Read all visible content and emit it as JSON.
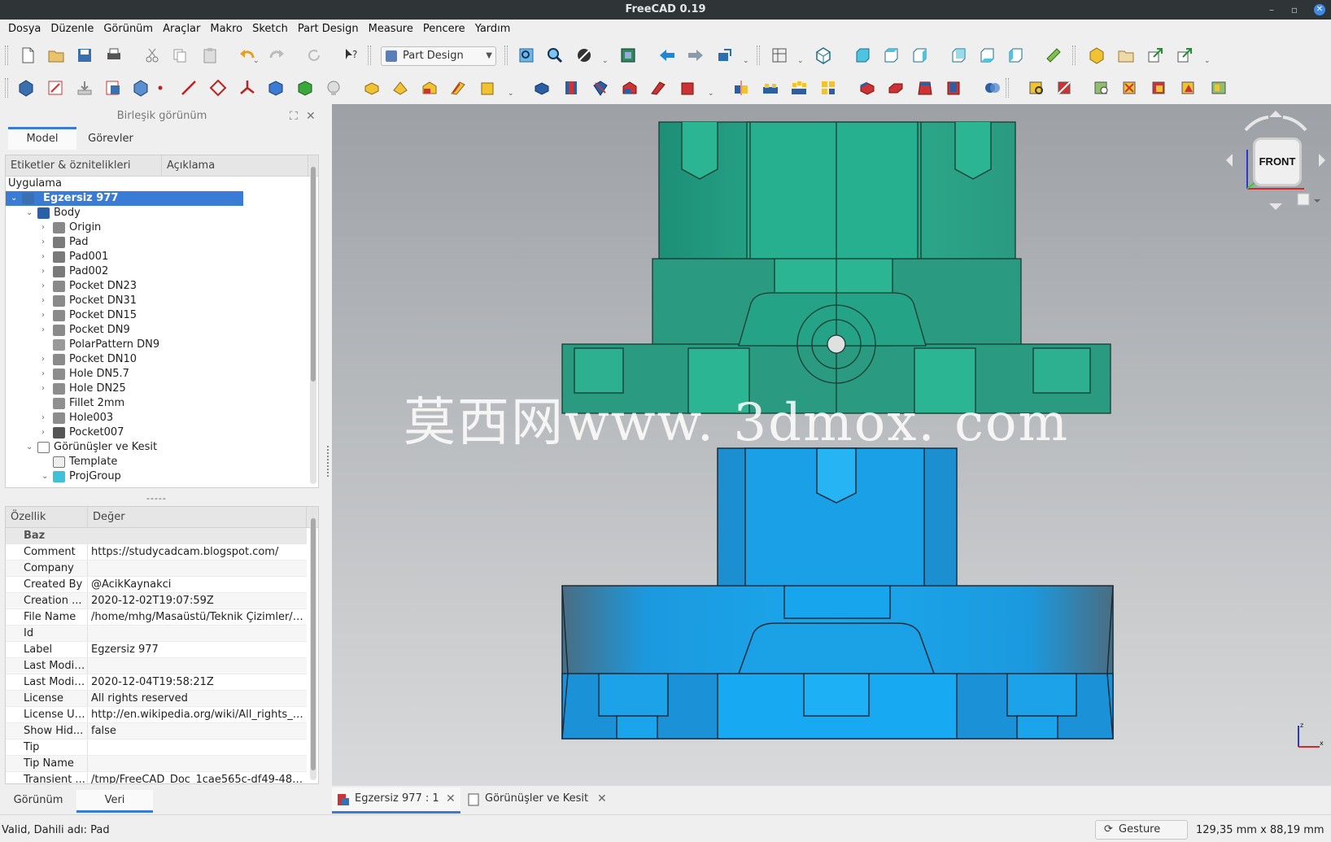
{
  "window": {
    "title": "FreeCAD 0.19",
    "minimize": "–",
    "restore": "▫",
    "close": "✕"
  },
  "menu": [
    "Dosya",
    "Düzenle",
    "Görünüm",
    "Araçlar",
    "Makro",
    "Sketch",
    "Part Design",
    "Measure",
    "Pencere",
    "Yardım"
  ],
  "workbench": {
    "selected": "Part Design"
  },
  "combo_view": {
    "title": "Birleşik görünüm",
    "tabs": [
      "Model",
      "Görevler"
    ],
    "active_tab": "Model"
  },
  "tree": {
    "columns": [
      "Etiketler & öznitelikleri",
      "Açıklama"
    ],
    "root_label": "Uygulama",
    "items": [
      {
        "label": "Egzersiz 977",
        "level": 0,
        "expander": "open",
        "icon": "document-icon",
        "selected": true
      },
      {
        "label": "Body",
        "level": 1,
        "expander": "open",
        "icon": "body-icon"
      },
      {
        "label": "Origin",
        "level": 2,
        "expander": "closed",
        "icon": "origin-icon"
      },
      {
        "label": "Pad",
        "level": 2,
        "expander": "closed",
        "icon": "pad-icon"
      },
      {
        "label": "Pad001",
        "level": 2,
        "expander": "closed",
        "icon": "pad-icon"
      },
      {
        "label": "Pad002",
        "level": 2,
        "expander": "closed",
        "icon": "pad-icon"
      },
      {
        "label": "Pocket DN23",
        "level": 2,
        "expander": "closed",
        "icon": "pocket-icon"
      },
      {
        "label": "Pocket DN31",
        "level": 2,
        "expander": "closed",
        "icon": "pocket-icon"
      },
      {
        "label": "Pocket DN15",
        "level": 2,
        "expander": "closed",
        "icon": "pocket-icon"
      },
      {
        "label": "Pocket DN9",
        "level": 2,
        "expander": "closed",
        "icon": "pocket-icon"
      },
      {
        "label": "PolarPattern DN9",
        "level": 2,
        "expander": "none",
        "icon": "polar-pattern-icon"
      },
      {
        "label": "Pocket DN10",
        "level": 2,
        "expander": "closed",
        "icon": "pocket-icon"
      },
      {
        "label": "Hole DN5.7",
        "level": 2,
        "expander": "closed",
        "icon": "hole-icon"
      },
      {
        "label": "Hole DN25",
        "level": 2,
        "expander": "closed",
        "icon": "hole-icon"
      },
      {
        "label": "Fillet 2mm",
        "level": 2,
        "expander": "none",
        "icon": "fillet-icon"
      },
      {
        "label": "Hole003",
        "level": 2,
        "expander": "closed",
        "icon": "hole-icon"
      },
      {
        "label": "Pocket007",
        "level": 2,
        "expander": "closed",
        "icon": "pocket-tip-icon"
      },
      {
        "label": "Görünüşler ve Kesit",
        "level": 1,
        "expander": "open",
        "icon": "page-icon"
      },
      {
        "label": "Template",
        "level": 2,
        "expander": "none",
        "icon": "template-icon"
      },
      {
        "label": "ProjGroup",
        "level": 2,
        "expander": "open",
        "icon": "projgroup-icon"
      }
    ]
  },
  "properties": {
    "columns": [
      "Özellik",
      "Değer"
    ],
    "group": "Baz",
    "rows": [
      {
        "name": "Comment",
        "value": "https://studycadcam.blogspot.com/"
      },
      {
        "name": "Company",
        "value": ""
      },
      {
        "name": "Created By",
        "value": "@AcikKaynakci"
      },
      {
        "name": "Creation ...",
        "value": "2020-12-02T19:07:59Z"
      },
      {
        "name": "File Name",
        "value": "/home/mhg/Masaüstü/Teknik Çizimler/Eg..."
      },
      {
        "name": "Id",
        "value": ""
      },
      {
        "name": "Label",
        "value": "Egzersiz 977"
      },
      {
        "name": "Last Modif...",
        "value": ""
      },
      {
        "name": "Last Modif...",
        "value": "2020-12-04T19:58:21Z"
      },
      {
        "name": "License",
        "value": "All rights reserved"
      },
      {
        "name": "License URL",
        "value": "http://en.wikipedia.org/wiki/All_rights_res..."
      },
      {
        "name": "Show Hid...",
        "value": "false"
      },
      {
        "name": "Tip",
        "value": ""
      },
      {
        "name": "Tip Name",
        "value": ""
      },
      {
        "name": "Transient ...",
        "value": "/tmp/FreeCAD_Doc_1cae565c-df49-4833-..."
      }
    ],
    "tabs": [
      "Görünüm",
      "Veri"
    ],
    "active_tab": "Veri"
  },
  "view3d": {
    "watermark": "莫西网www. 3dmox. com",
    "navcube_face": "FRONT",
    "top_part_color": "#2aa88a",
    "bottom_part_color": "#1e9ee0",
    "background_top": "#9da1a6",
    "background_bottom": "#d9dadb"
  },
  "doc_tabs": [
    {
      "label": "Egzersiz 977 : 1",
      "active": true
    },
    {
      "label": "Görünüşler ve Kesit",
      "active": false
    }
  ],
  "status": {
    "message": "Valid, Dahili adı: Pad",
    "nav_style": "Gesture",
    "dimensions": "129,35 mm x 88,19 mm"
  },
  "colors": {
    "accent": "#3a7bd5",
    "titlebar": "#2f3437"
  }
}
